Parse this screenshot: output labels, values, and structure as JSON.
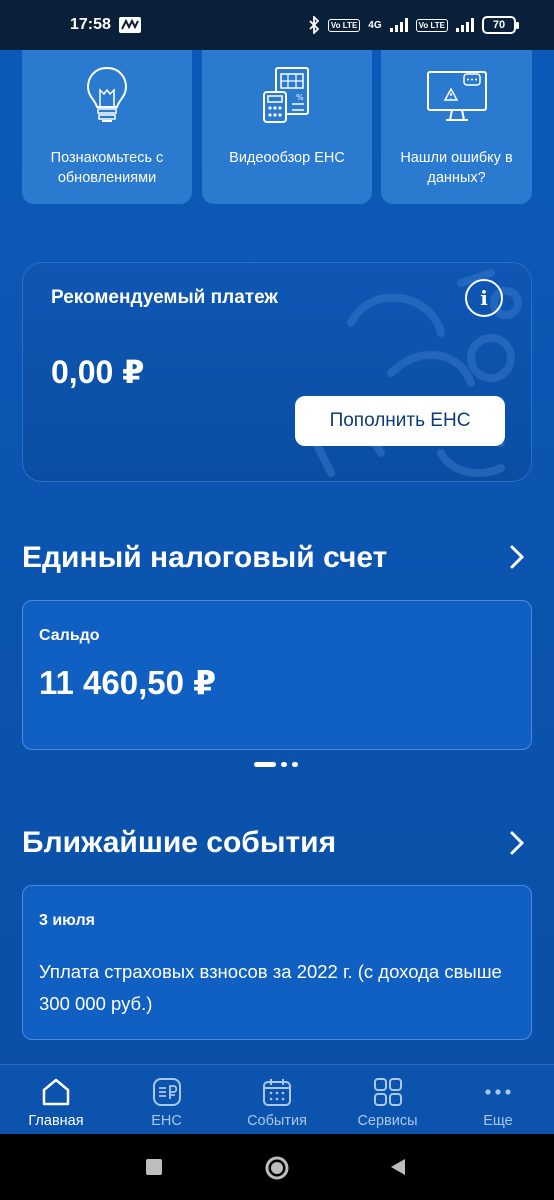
{
  "status_bar": {
    "time": "17:58",
    "network_label": "4G",
    "volte_label_1": "Vo LTE",
    "volte_label_2": "Vo LTE",
    "battery": "70"
  },
  "quick_cards": [
    {
      "label": "Познакомьтесь с обновлениями",
      "icon": "lightbulb-icon"
    },
    {
      "label": "Видеообзор ЕНС",
      "icon": "calculator-document-icon"
    },
    {
      "label": "Нашли ошибку в данных?",
      "icon": "monitor-warning-icon"
    }
  ],
  "payment": {
    "title": "Рекомендуемый платеж",
    "amount": "0,00 ₽",
    "button": "Пополнить ЕНС",
    "info_icon": "info-icon"
  },
  "ens_section": {
    "title": "Единый налоговый счет",
    "saldo_label": "Сальдо",
    "saldo_value": "11 460,50 ₽"
  },
  "events_section": {
    "title": "Ближайшие события",
    "event_date": "3 июля",
    "event_text": "Уплата страховых взносов за 2022 г. (с дохода свыше 300 000 руб.)"
  },
  "bottom_nav": [
    {
      "label": "Главная",
      "icon": "home-icon",
      "active": true
    },
    {
      "label": "ЕНС",
      "icon": "ens-document-icon",
      "active": false
    },
    {
      "label": "События",
      "icon": "calendar-icon",
      "active": false
    },
    {
      "label": "Сервисы",
      "icon": "grid-icon",
      "active": false
    },
    {
      "label": "Еще",
      "icon": "more-dots-icon",
      "active": false
    }
  ],
  "colors": {
    "background": "#0c5bb8",
    "card": "#1060c3",
    "quick_card": "#2a7ad0",
    "button_text": "#0d3c7a",
    "status_bar": "#0a1f3a"
  }
}
